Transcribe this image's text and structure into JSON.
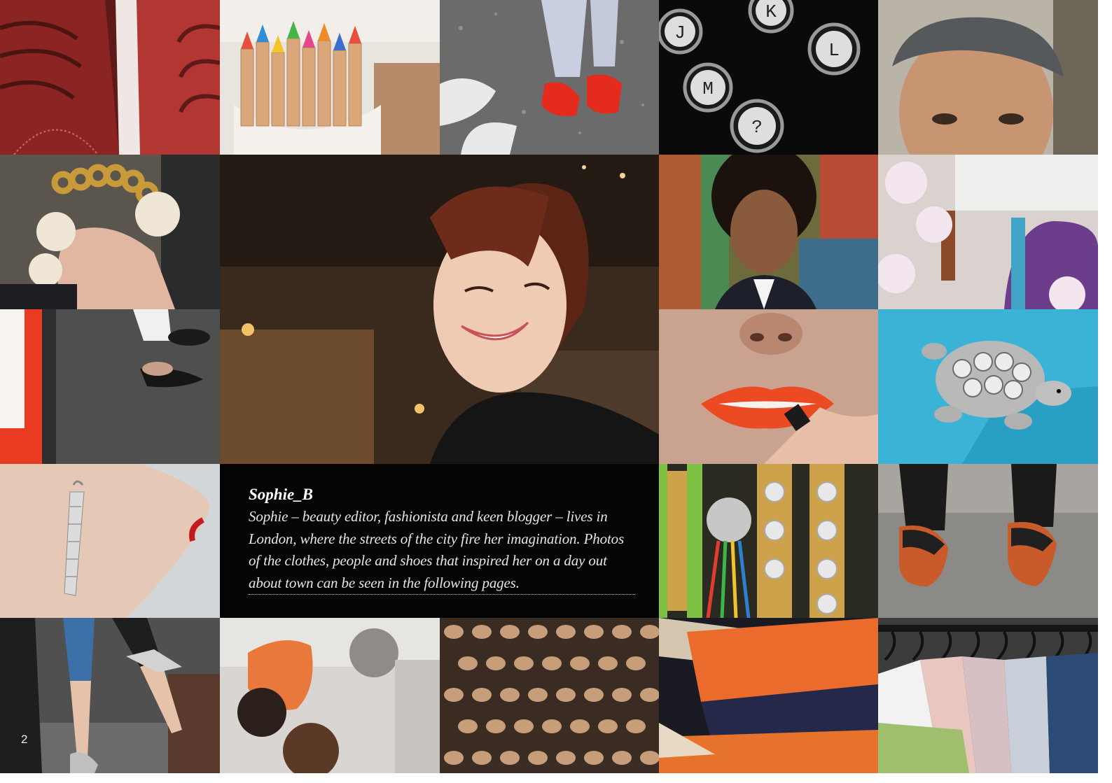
{
  "caption": {
    "name": "Sophie_B",
    "body": "Sophie – beauty editor, fashionista and keen blogger – lives in London, where the streets of the city fire her imagination. Photos of the clothes, people and shoes that inspired her on a day out about town can be seen in the following pages."
  },
  "page_number": "2",
  "photos": {
    "p1": {
      "icon": "red-leather-shoes-icon"
    },
    "p2": {
      "icon": "colored-pencils-icon",
      "letters": ""
    },
    "p3": {
      "icon": "red-heels-on-street-icon"
    },
    "p4": {
      "icon": "typewriter-keys-icon",
      "letters": [
        "J",
        "K",
        "M",
        "L",
        "?"
      ]
    },
    "p5": {
      "icon": "man-in-flat-cap-icon"
    },
    "p6": {
      "icon": "pearl-jewellery-hand-icon"
    },
    "p7": {
      "icon": "smiling-woman-portrait-icon"
    },
    "p8": {
      "icon": "curly-hair-man-icon"
    },
    "p9": {
      "icon": "shop-window-orchids-icon"
    },
    "p10": {
      "icon": "studded-slippers-icon"
    },
    "p11": {
      "icon": "orange-lipstick-icon"
    },
    "p12": {
      "icon": "turtle-brooch-icon"
    },
    "p13": {
      "icon": "diamond-earring-icon"
    },
    "p14": {
      "icon": "friendship-bracelets-icon"
    },
    "p15": {
      "icon": "brogue-boots-icon"
    },
    "p16": {
      "icon": "high-heels-legs-icon"
    },
    "p17": {
      "icon": "makeup-brushes-icon"
    },
    "p18": {
      "icon": "sequins-icon"
    },
    "p19": {
      "icon": "leather-notebooks-icon"
    },
    "p20": {
      "icon": "clothes-rail-icon"
    }
  }
}
